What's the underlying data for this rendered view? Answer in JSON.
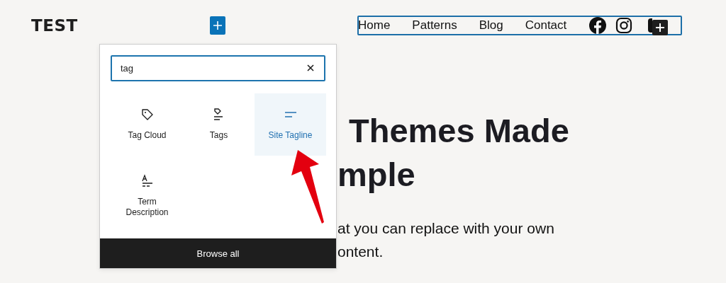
{
  "site_title": "TEST",
  "nav": {
    "items": [
      "Home",
      "Patterns",
      "Blog",
      "Contact"
    ]
  },
  "inserter": {
    "search": {
      "value": "tag"
    },
    "blocks": [
      {
        "label": "Tag Cloud",
        "kind": "tag-cloud",
        "selected": false
      },
      {
        "label": "Tags",
        "kind": "tags",
        "selected": false
      },
      {
        "label": "Site Tagline",
        "kind": "tagline",
        "selected": true
      },
      {
        "label": "Term Description",
        "kind": "term-description",
        "selected": false
      }
    ],
    "browse_all": "Browse all"
  },
  "hero": {
    "heading_lines": [
      "Themes Made",
      "mple"
    ],
    "text_lines": [
      "at you can replace with your own",
      "ontent."
    ]
  }
}
